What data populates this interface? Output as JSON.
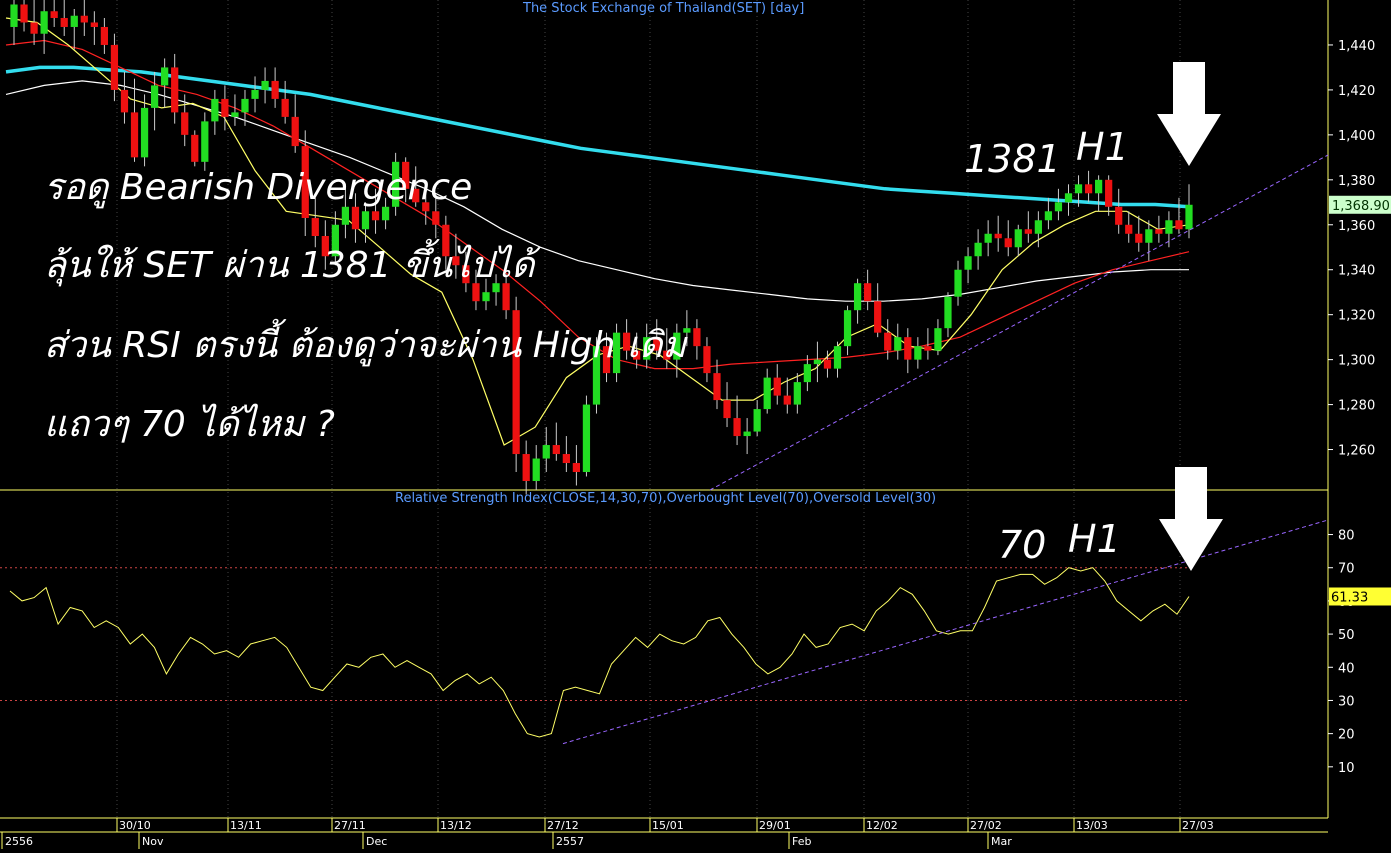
{
  "price_panel": {
    "title": "The Stock Exchange of Thailand(SET) [day]",
    "last_value_label": "1,368.90"
  },
  "rsi_panel": {
    "title": "Relative Strength Index(CLOSE,14,30,70),Overbought Level(70),Oversold Level(30)",
    "last_value_label": "61.33"
  },
  "annotations": {
    "line1": "รอดู Bearish Divergence",
    "line2": "ลุ้นให้ SET ผ่าน 1381 ขึ้นไปได้",
    "line3": "ส่วน RSI ตรงนี้ ต้องดูว่าจะผ่าน High เดิม",
    "line4": "แถวๆ 70 ได้ไหม ?",
    "price_level": "1381",
    "price_high": "H1",
    "rsi_level": "70",
    "rsi_high": "H1"
  },
  "colors": {
    "background": "#000000",
    "up_candle": "#22dd22",
    "down_candle": "#ee1111",
    "sma_long": "#33ddee",
    "ema_mid": "#ffffff",
    "ema_short": "#ff2222",
    "ema_fast": "#ffff66",
    "rsi_line": "#ffff66",
    "trendline": "#9966ff",
    "level_line": "#cc4444",
    "axis_text": "#ffffff",
    "border": "#ffff66"
  },
  "chart_data": [
    {
      "type": "candlestick",
      "title": "The Stock Exchange of Thailand(SET) [day]",
      "y_ticks": [
        1260,
        1280,
        1300,
        1320,
        1340,
        1360,
        1380,
        1400,
        1420,
        1440
      ],
      "y_tick_labels": [
        "1,260",
        "1,280",
        "1,300",
        "1,320",
        "1,340",
        "1,360",
        "1,380",
        "1,400",
        "1,420",
        "1,440"
      ],
      "ylim": [
        1242,
        1460
      ],
      "last_value": 1368.9,
      "x_day_ticks": [
        "30/10",
        "13/11",
        "27/11",
        "13/12",
        "27/12",
        "15/01",
        "29/01",
        "12/02",
        "27/02",
        "13/03",
        "27/03"
      ],
      "x_month_labels": [
        "2556",
        "Nov",
        "Dec",
        "2557",
        "Feb",
        "Mar"
      ],
      "candles": [
        [
          1448,
          1460,
          1440,
          1458
        ],
        [
          1458,
          1464,
          1446,
          1450
        ],
        [
          1450,
          1462,
          1440,
          1445
        ],
        [
          1445,
          1460,
          1436,
          1455
        ],
        [
          1455,
          1462,
          1448,
          1452
        ],
        [
          1452,
          1460,
          1444,
          1448
        ],
        [
          1448,
          1456,
          1438,
          1453
        ],
        [
          1453,
          1460,
          1444,
          1450
        ],
        [
          1450,
          1455,
          1440,
          1448
        ],
        [
          1448,
          1452,
          1436,
          1440
        ],
        [
          1440,
          1445,
          1415,
          1420
        ],
        [
          1420,
          1428,
          1405,
          1410
        ],
        [
          1410,
          1425,
          1388,
          1390
        ],
        [
          1390,
          1418,
          1386,
          1412
        ],
        [
          1412,
          1428,
          1402,
          1422
        ],
        [
          1422,
          1434,
          1412,
          1430
        ],
        [
          1430,
          1436,
          1405,
          1410
        ],
        [
          1410,
          1418,
          1395,
          1400
        ],
        [
          1400,
          1402,
          1386,
          1388
        ],
        [
          1388,
          1410,
          1384,
          1406
        ],
        [
          1406,
          1420,
          1400,
          1416
        ],
        [
          1416,
          1422,
          1402,
          1408
        ],
        [
          1408,
          1418,
          1404,
          1410
        ],
        [
          1410,
          1420,
          1404,
          1416
        ],
        [
          1416,
          1426,
          1410,
          1420
        ],
        [
          1420,
          1430,
          1414,
          1424
        ],
        [
          1424,
          1430,
          1412,
          1416
        ],
        [
          1416,
          1424,
          1405,
          1408
        ],
        [
          1408,
          1418,
          1392,
          1395
        ],
        [
          1395,
          1402,
          1355,
          1363
        ],
        [
          1363,
          1372,
          1350,
          1355
        ],
        [
          1355,
          1362,
          1340,
          1346
        ],
        [
          1346,
          1366,
          1342,
          1360
        ],
        [
          1360,
          1378,
          1354,
          1368
        ],
        [
          1368,
          1374,
          1352,
          1358
        ],
        [
          1358,
          1370,
          1352,
          1366
        ],
        [
          1366,
          1376,
          1356,
          1362
        ],
        [
          1362,
          1372,
          1358,
          1368
        ],
        [
          1368,
          1392,
          1364,
          1388
        ],
        [
          1388,
          1390,
          1370,
          1376
        ],
        [
          1376,
          1386,
          1368,
          1370
        ],
        [
          1370,
          1378,
          1360,
          1366
        ],
        [
          1366,
          1372,
          1354,
          1360
        ],
        [
          1360,
          1364,
          1340,
          1346
        ],
        [
          1346,
          1356,
          1336,
          1342
        ],
        [
          1342,
          1348,
          1330,
          1334
        ],
        [
          1334,
          1340,
          1322,
          1326
        ],
        [
          1326,
          1336,
          1322,
          1330
        ],
        [
          1330,
          1338,
          1324,
          1334
        ],
        [
          1334,
          1338,
          1318,
          1322
        ],
        [
          1322,
          1328,
          1250,
          1258
        ],
        [
          1258,
          1264,
          1240,
          1246
        ],
        [
          1246,
          1262,
          1242,
          1256
        ],
        [
          1256,
          1270,
          1250,
          1262
        ],
        [
          1262,
          1272,
          1255,
          1258
        ],
        [
          1258,
          1266,
          1250,
          1254
        ],
        [
          1254,
          1262,
          1244,
          1250
        ],
        [
          1250,
          1284,
          1248,
          1280
        ],
        [
          1280,
          1310,
          1276,
          1306
        ],
        [
          1306,
          1312,
          1290,
          1294
        ],
        [
          1294,
          1316,
          1290,
          1312
        ],
        [
          1312,
          1318,
          1300,
          1304
        ],
        [
          1304,
          1312,
          1296,
          1300
        ],
        [
          1300,
          1316,
          1296,
          1310
        ],
        [
          1310,
          1318,
          1300,
          1304
        ],
        [
          1304,
          1314,
          1296,
          1300
        ],
        [
          1300,
          1316,
          1292,
          1312
        ],
        [
          1312,
          1322,
          1306,
          1314
        ],
        [
          1314,
          1318,
          1300,
          1306
        ],
        [
          1306,
          1310,
          1290,
          1294
        ],
        [
          1294,
          1300,
          1278,
          1282
        ],
        [
          1282,
          1290,
          1270,
          1274
        ],
        [
          1274,
          1284,
          1262,
          1266
        ],
        [
          1266,
          1274,
          1258,
          1268
        ],
        [
          1268,
          1282,
          1266,
          1278
        ],
        [
          1278,
          1296,
          1276,
          1292
        ],
        [
          1292,
          1298,
          1280,
          1284
        ],
        [
          1284,
          1292,
          1276,
          1280
        ],
        [
          1280,
          1294,
          1276,
          1290
        ],
        [
          1290,
          1302,
          1286,
          1298
        ],
        [
          1298,
          1308,
          1290,
          1300
        ],
        [
          1300,
          1304,
          1292,
          1296
        ],
        [
          1296,
          1308,
          1292,
          1306
        ],
        [
          1306,
          1324,
          1302,
          1322
        ],
        [
          1322,
          1336,
          1316,
          1334
        ],
        [
          1334,
          1340,
          1322,
          1326
        ],
        [
          1326,
          1334,
          1310,
          1312
        ],
        [
          1312,
          1318,
          1300,
          1304
        ],
        [
          1304,
          1316,
          1300,
          1310
        ],
        [
          1310,
          1314,
          1294,
          1300
        ],
        [
          1300,
          1310,
          1296,
          1306
        ],
        [
          1306,
          1314,
          1300,
          1304
        ],
        [
          1304,
          1318,
          1302,
          1314
        ],
        [
          1314,
          1330,
          1310,
          1328
        ],
        [
          1328,
          1344,
          1324,
          1340
        ],
        [
          1340,
          1350,
          1334,
          1346
        ],
        [
          1346,
          1358,
          1340,
          1352
        ],
        [
          1352,
          1362,
          1346,
          1356
        ],
        [
          1356,
          1364,
          1348,
          1354
        ],
        [
          1354,
          1362,
          1346,
          1350
        ],
        [
          1350,
          1360,
          1346,
          1358
        ],
        [
          1358,
          1366,
          1352,
          1356
        ],
        [
          1356,
          1366,
          1350,
          1362
        ],
        [
          1362,
          1372,
          1358,
          1366
        ],
        [
          1366,
          1376,
          1362,
          1370
        ],
        [
          1370,
          1378,
          1364,
          1374
        ],
        [
          1374,
          1382,
          1368,
          1378
        ],
        [
          1378,
          1384,
          1370,
          1374
        ],
        [
          1374,
          1382,
          1366,
          1380
        ],
        [
          1380,
          1382,
          1364,
          1368
        ],
        [
          1368,
          1376,
          1356,
          1360
        ],
        [
          1360,
          1366,
          1352,
          1356
        ],
        [
          1356,
          1364,
          1348,
          1352
        ],
        [
          1352,
          1362,
          1344,
          1358
        ],
        [
          1358,
          1364,
          1352,
          1356
        ],
        [
          1356,
          1366,
          1350,
          1362
        ],
        [
          1362,
          1372,
          1356,
          1358
        ],
        [
          1358,
          1378,
          1354,
          1368.9
        ]
      ],
      "moving_averages": [
        {
          "color": "#33ddee",
          "values": [
            1428,
            1430,
            1430,
            1429,
            1428,
            1426,
            1424,
            1422,
            1420,
            1418,
            1415,
            1412,
            1409,
            1406,
            1403,
            1400,
            1397,
            1394,
            1392,
            1390,
            1388,
            1386,
            1384,
            1382,
            1380,
            1378,
            1376,
            1375,
            1374,
            1373,
            1372,
            1371,
            1370,
            1369,
            1369,
            1368
          ]
        },
        {
          "color": "#ffffff",
          "values": [
            1418,
            1422,
            1424,
            1422,
            1418,
            1413,
            1408,
            1402,
            1396,
            1390,
            1383,
            1376,
            1368,
            1358,
            1350,
            1344,
            1340,
            1336,
            1333,
            1331,
            1329,
            1327,
            1326,
            1326,
            1327,
            1329,
            1332,
            1335,
            1337,
            1339,
            1340,
            1340
          ]
        },
        {
          "color": "#ff2222",
          "values": [
            1440,
            1442,
            1438,
            1430,
            1422,
            1418,
            1412,
            1404,
            1394,
            1384,
            1374,
            1364,
            1352,
            1340,
            1326,
            1310,
            1300,
            1296,
            1296,
            1298,
            1299,
            1300,
            1301,
            1303,
            1306,
            1310,
            1318,
            1326,
            1334,
            1340,
            1344,
            1348
          ]
        },
        {
          "color": "#ffff66",
          "values": [
            1452,
            1450,
            1440,
            1428,
            1416,
            1412,
            1414,
            1408,
            1384,
            1366,
            1364,
            1362,
            1350,
            1338,
            1330,
            1300,
            1262,
            1270,
            1292,
            1302,
            1306,
            1302,
            1292,
            1282,
            1282,
            1290,
            1296,
            1310,
            1316,
            1306,
            1304,
            1320,
            1340,
            1352,
            1360,
            1366,
            1366,
            1358,
            1360
          ]
        }
      ],
      "trendline": {
        "from": [
          1,
          1240
        ],
        "to": [
          1.16,
          1390
        ]
      }
    },
    {
      "type": "line",
      "title": "Relative Strength Index(CLOSE,14,30,70),Overbought Level(70),Oversold Level(30)",
      "y_ticks": [
        10,
        20,
        30,
        40,
        50,
        60,
        70,
        80
      ],
      "ylim": [
        0,
        88
      ],
      "levels": [
        70,
        30
      ],
      "last_value": 61.33,
      "values": [
        63,
        60,
        61,
        64,
        53,
        58,
        57,
        52,
        54,
        52,
        47,
        50,
        46,
        38,
        44,
        49,
        47,
        44,
        45,
        43,
        47,
        48,
        49,
        46,
        40,
        34,
        33,
        37,
        41,
        40,
        43,
        44,
        40,
        42,
        40,
        38,
        33,
        36,
        38,
        35,
        37,
        33,
        26,
        20,
        19,
        20,
        33,
        34,
        33,
        32,
        41,
        45,
        49,
        46,
        50,
        48,
        47,
        49,
        54,
        55,
        50,
        46,
        41,
        38,
        40,
        44,
        50,
        46,
        47,
        52,
        53,
        51,
        57,
        60,
        64,
        62,
        57,
        51,
        50,
        51,
        51,
        58,
        66,
        67,
        68,
        68,
        65,
        67,
        70,
        69,
        70,
        66,
        60,
        57,
        54,
        57,
        59,
        56,
        61.33
      ],
      "trendline": {
        "from": [
          0.57,
          17
        ],
        "to": [
          1.35,
          82
        ]
      }
    }
  ]
}
